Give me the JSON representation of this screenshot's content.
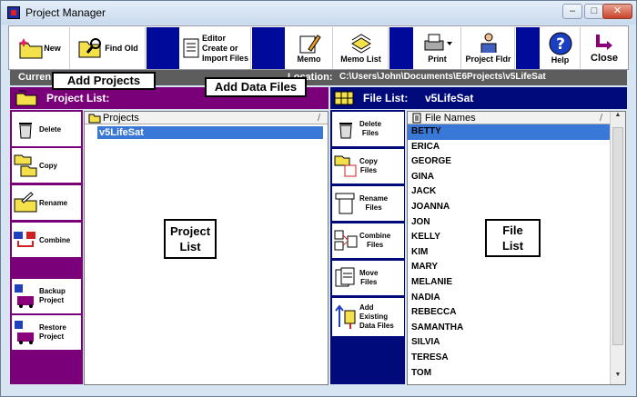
{
  "window": {
    "title": "Project Manager",
    "minimize": "–",
    "maximize": "□",
    "close": "✕"
  },
  "toolbar": {
    "new": "New",
    "find_old": "Find Old",
    "editor_line1": "Editor",
    "editor_line2": "Create or",
    "editor_line3": "Import Files",
    "memo": "Memo",
    "memo_list": "Memo List",
    "print": "Print",
    "project_fldr": "Project Fldr",
    "help": "Help",
    "close": "Close"
  },
  "pathbar": {
    "current_label": "Curren",
    "location_label": "Location:",
    "path": "C:\\Users\\John\\Documents\\E6Projects\\v5LifeSat"
  },
  "callouts": {
    "add_projects": "Add Projects",
    "add_data_files": "Add Data Files",
    "project_list_1": "Project",
    "project_list_2": "List",
    "file_list_1": "File",
    "file_list_2": "List"
  },
  "project_panel": {
    "heading": "Project List:",
    "buttons": {
      "delete": "Delete",
      "copy": "Copy",
      "rename": "Rename",
      "combine": "Combine",
      "backup_1": "Backup",
      "backup_2": "Project",
      "restore_1": "Restore",
      "restore_2": "Project"
    },
    "column_header": "Projects",
    "sort_glyph": "/",
    "items": [
      "v5LifeSat"
    ]
  },
  "file_panel": {
    "heading": "File List:",
    "project_name": "v5LifeSat",
    "buttons": {
      "delete_1": "Delete",
      "delete_2": "Files",
      "copy_1": "Copy",
      "copy_2": "Files",
      "rename_1": "Rename",
      "rename_2": "Files",
      "combine_1": "Combine",
      "combine_2": "Files",
      "move_1": "Move",
      "move_2": "Files",
      "add_1": "Add",
      "add_2": "Existing",
      "add_3": "Data Files"
    },
    "column_header": "File Names",
    "sort_glyph": "/",
    "files": [
      "BETTY",
      "ERICA",
      "GEORGE",
      "GINA",
      "JACK",
      "JOANNA",
      "JON",
      "KELLY",
      "KIM",
      "MARY",
      "MELANIE",
      "NADIA",
      "REBECCA",
      "SAMANTHA",
      "SILVIA",
      "TERESA",
      "TOM"
    ]
  },
  "colors": {
    "purple": "#7a007a",
    "navy": "#000a7a",
    "selection": "#3a78d7"
  }
}
